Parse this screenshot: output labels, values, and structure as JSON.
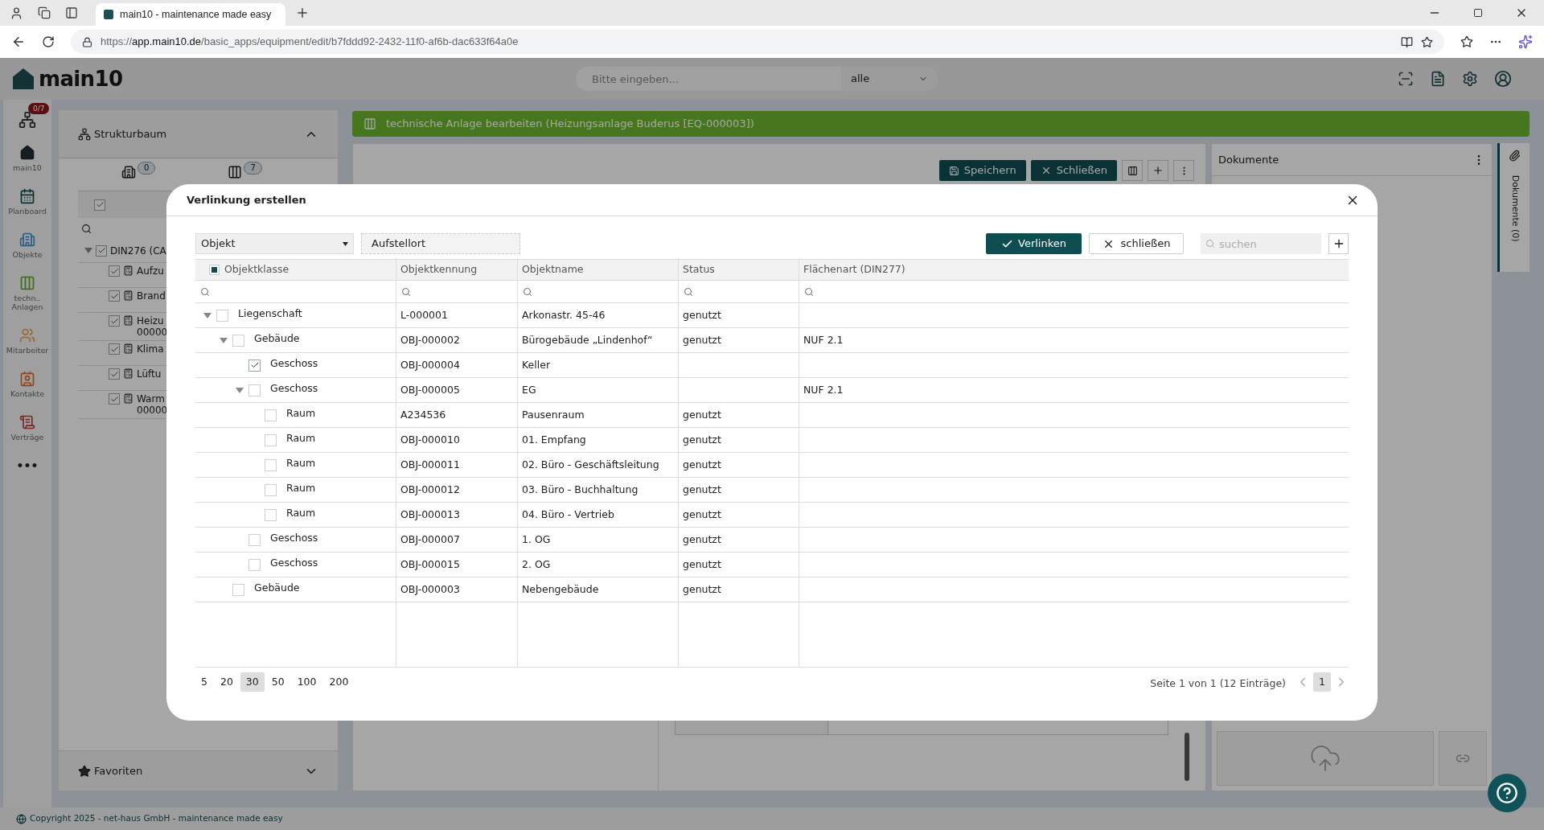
{
  "browser": {
    "tab_title": "main10 - maintenance made easy",
    "url_scheme": "https://",
    "url_host": "app.main10.de",
    "url_path": "/basic_apps/equipment/edit/b7fddd92-2432-11f0-af6b-dac633f64a0e"
  },
  "app": {
    "logo": "main10",
    "search_placeholder": "Bitte eingeben...",
    "scope": "alle"
  },
  "sidebar": {
    "badge": "0/7",
    "items": [
      {
        "kind": "home",
        "label": "main10"
      },
      {
        "kind": "planboard",
        "label": "Planboard"
      },
      {
        "kind": "objects",
        "label": "Objekte"
      },
      {
        "kind": "equipment",
        "label": "techn.. Anlagen"
      },
      {
        "kind": "staff",
        "label": "Mitarbeiter"
      },
      {
        "kind": "contacts",
        "label": "Kontakte"
      },
      {
        "kind": "contracts",
        "label": "Verträge"
      },
      {
        "kind": "more",
        "label": "•••"
      }
    ]
  },
  "structure_panel": {
    "title": "Strukturbaum",
    "tabs": [
      {
        "count": "0"
      },
      {
        "count": "7"
      }
    ],
    "header_checked": true,
    "root": {
      "label": "DIN276 (CA",
      "checked": true,
      "expanded": true
    },
    "items": [
      {
        "lines": [
          "Aufzu"
        ],
        "checked": true
      },
      {
        "lines": [
          "Brand"
        ],
        "checked": true
      },
      {
        "lines": [
          "Heizu",
          "00000"
        ],
        "checked": true
      },
      {
        "lines": [
          "Klima"
        ],
        "checked": true
      },
      {
        "lines": [
          "Lüftu"
        ],
        "checked": true
      },
      {
        "lines": [
          "Warm",
          "00000"
        ],
        "checked": true
      }
    ],
    "favorites": "Favoriten"
  },
  "page": {
    "title": "technische Anlage bearbeiten (Heizungsanlage Buderus [EQ-000003])",
    "save": "Speichern",
    "close": "Schließen",
    "documents_title": "Dokumente",
    "documents_tab": "Dokumente (0)"
  },
  "footer": "Copyright 2025 - net-haus GmbH - maintenance made easy",
  "dialog": {
    "title": "Verlinkung erstellen",
    "type_select": "Objekt",
    "location_field": "Aufstellort",
    "link_button": "Verlinken",
    "close_button": "schließen",
    "search_placeholder": "suchen",
    "select_all_indeterminate": true,
    "columns": [
      {
        "label": "Objektklasse"
      },
      {
        "label": "Objektkennung"
      },
      {
        "label": "Objektname"
      },
      {
        "label": "Status"
      },
      {
        "label": "Flächenart (DIN277)"
      }
    ],
    "rows": [
      {
        "class": "Liegenschaft",
        "id": "L-000001",
        "name": "Arkonastr. 45-46",
        "status": "genutzt",
        "checked": false,
        "expanded": true,
        "children": [
          {
            "class": "Gebäude",
            "id": "OBJ-000002",
            "name": "Bürogebäude „Lindenhof“",
            "status": "genutzt",
            "area": "NUF 2.1",
            "checked": false,
            "expanded": true,
            "children": [
              {
                "class": "Geschoss",
                "id": "OBJ-000004",
                "name": "Keller",
                "checked": true
              },
              {
                "class": "Geschoss",
                "id": "OBJ-000005",
                "name": "EG",
                "area": "NUF 2.1",
                "checked": false,
                "expanded": true,
                "children": [
                  {
                    "class": "Raum",
                    "id": "A234536",
                    "name": "Pausenraum",
                    "status": "genutzt",
                    "checked": false
                  },
                  {
                    "class": "Raum",
                    "id": "OBJ-000010",
                    "name": "01. Empfang",
                    "status": "genutzt",
                    "checked": false
                  },
                  {
                    "class": "Raum",
                    "id": "OBJ-000011",
                    "name": "02. Büro - Geschäftsleitung",
                    "status": "genutzt",
                    "checked": false
                  },
                  {
                    "class": "Raum",
                    "id": "OBJ-000012",
                    "name": "03. Büro - Buchhaltung",
                    "status": "genutzt",
                    "checked": false
                  },
                  {
                    "class": "Raum",
                    "id": "OBJ-000013",
                    "name": "04. Büro - Vertrieb",
                    "status": "genutzt",
                    "checked": false
                  }
                ]
              },
              {
                "class": "Geschoss",
                "id": "OBJ-000007",
                "name": "1. OG",
                "status": "genutzt",
                "checked": false
              },
              {
                "class": "Geschoss",
                "id": "OBJ-000015",
                "name": "2. OG",
                "status": "genutzt",
                "checked": false
              }
            ]
          },
          {
            "class": "Gebäude",
            "id": "OBJ-000003",
            "name": "Nebengebäude",
            "status": "genutzt",
            "checked": false
          }
        ]
      }
    ],
    "page_sizes": [
      {
        "label": "5",
        "selected": false
      },
      {
        "label": "20",
        "selected": false
      },
      {
        "label": "30",
        "selected": true
      },
      {
        "label": "50",
        "selected": false
      },
      {
        "label": "100",
        "selected": false
      },
      {
        "label": "200",
        "selected": false
      }
    ],
    "summary": "Seite 1 von 1 (12 Einträge)",
    "pages": [
      {
        "label": "1",
        "selected": true
      }
    ]
  }
}
